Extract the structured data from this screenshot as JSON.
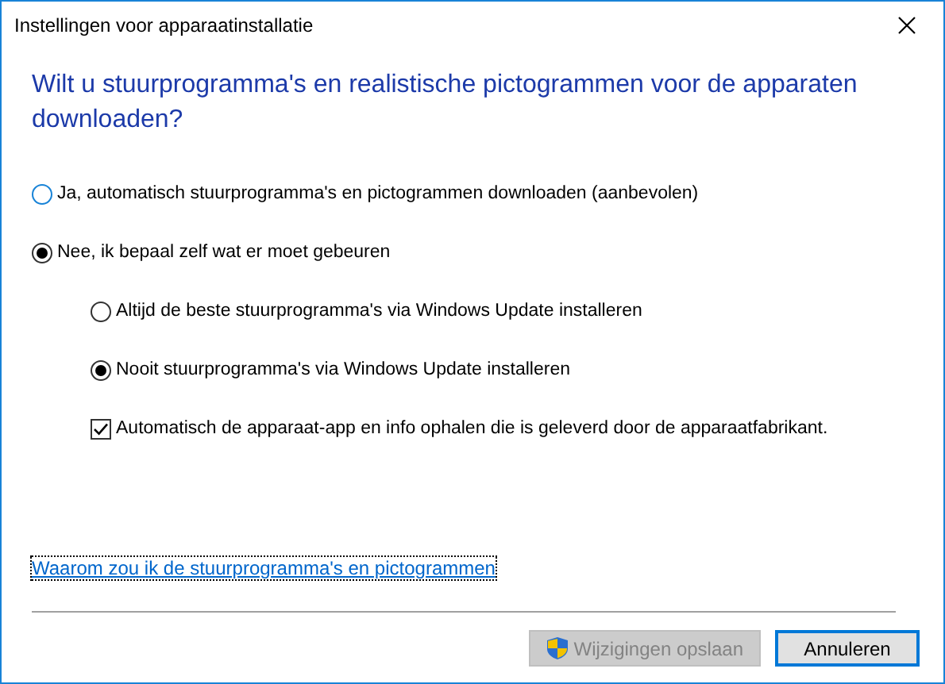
{
  "window": {
    "title": "Instellingen voor apparaatinstallatie"
  },
  "heading": "Wilt u stuurprogramma's en realistische pictogrammen voor de apparaten downloaden?",
  "options": [
    {
      "kind": "radio",
      "label": "Ja, automatisch stuurprogramma's en pictogrammen downloaden (aanbevolen)",
      "selected": false,
      "focused": true
    },
    {
      "kind": "radio",
      "label": "Nee, ik bepaal zelf wat er moet gebeuren",
      "selected": true,
      "children": [
        {
          "kind": "radio",
          "label": "Altijd de beste stuurprogramma's via Windows Update installeren",
          "selected": false
        },
        {
          "kind": "radio",
          "label": "Nooit stuurprogramma's via Windows Update installeren",
          "selected": true
        },
        {
          "kind": "checkbox",
          "label": "Automatisch de apparaat-app en info ophalen die is geleverd door de apparaatfabrikant.",
          "checked": true
        }
      ]
    }
  ],
  "link": "Waarom zou ik de stuurprogramma's en pictogrammen",
  "buttons": [
    {
      "label": "Wijzigingen opslaan",
      "disabled": true,
      "shield": true,
      "default": false
    },
    {
      "label": "Annuleren",
      "disabled": false,
      "shield": false,
      "default": true
    }
  ]
}
